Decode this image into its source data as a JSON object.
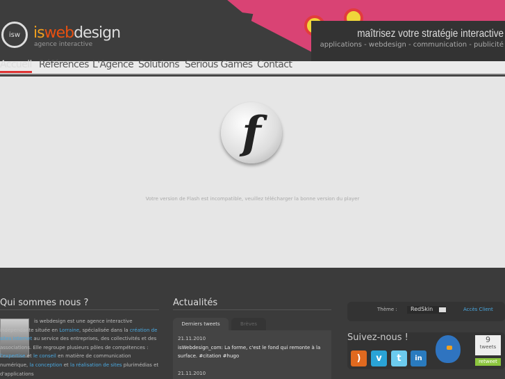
{
  "header": {
    "logo_mark": "isw",
    "logo_is": "is",
    "logo_web": "web",
    "logo_design": "design",
    "logo_sub": "agence interactive",
    "tagline": "maîtrisez votre stratégie interactive",
    "subtagline": "applications - webdesign - communication - publicité"
  },
  "nav": {
    "items": [
      {
        "label": "Accueil"
      },
      {
        "label": "Références"
      },
      {
        "label": "L'Agence"
      },
      {
        "label": "Solutions"
      },
      {
        "label": "Serious Games"
      },
      {
        "label": "Contact"
      }
    ]
  },
  "main": {
    "flash_message": "Votre version de Flash est incompatible, veuillez télécharger la bonne version du player",
    "flash_glyph": "f"
  },
  "about": {
    "title": "Qui sommes nous ?",
    "t1": "is webdesign est une agence interactive indépendante située en ",
    "l1": "Lorraine",
    "t2": ", spécialisée dans la ",
    "l2": "création de sites internet",
    "t3": " au service des entreprises, des collectivités et des associations. Elle regroupe plusieurs pôles de compétences : ",
    "l3": "l'expertise",
    "t4": " et ",
    "l4": "le conseil",
    "t5": " en matière de communication numérique, ",
    "l5": "la conception",
    "t6": " et ",
    "l6": "la réalisation de sites",
    "t7": " plurimédias et d'applications"
  },
  "news": {
    "title": "Actualités",
    "tabs": [
      "Derniers tweets",
      "Brèves"
    ],
    "tweets": [
      {
        "date": "21.11.2010",
        "text": "isWebdesign_com: La forme, c'est le fond qui remonte à la surface. #citation #hugo"
      },
      {
        "date": "21.11.2010"
      }
    ]
  },
  "sidebar": {
    "theme_label": "Thème :",
    "theme_value": "RedSkin",
    "client_link": "Accès Client",
    "follow_title": "Suivez-nous !",
    "social": [
      "rss",
      "vimeo",
      "twitter",
      "linkedin"
    ],
    "tweet_count": "9",
    "tweet_unit": "tweets",
    "retweet": "retweet"
  },
  "colors": {
    "accent": "#d33333",
    "link": "#4aa8e0",
    "retweet": "#8cc63f"
  }
}
